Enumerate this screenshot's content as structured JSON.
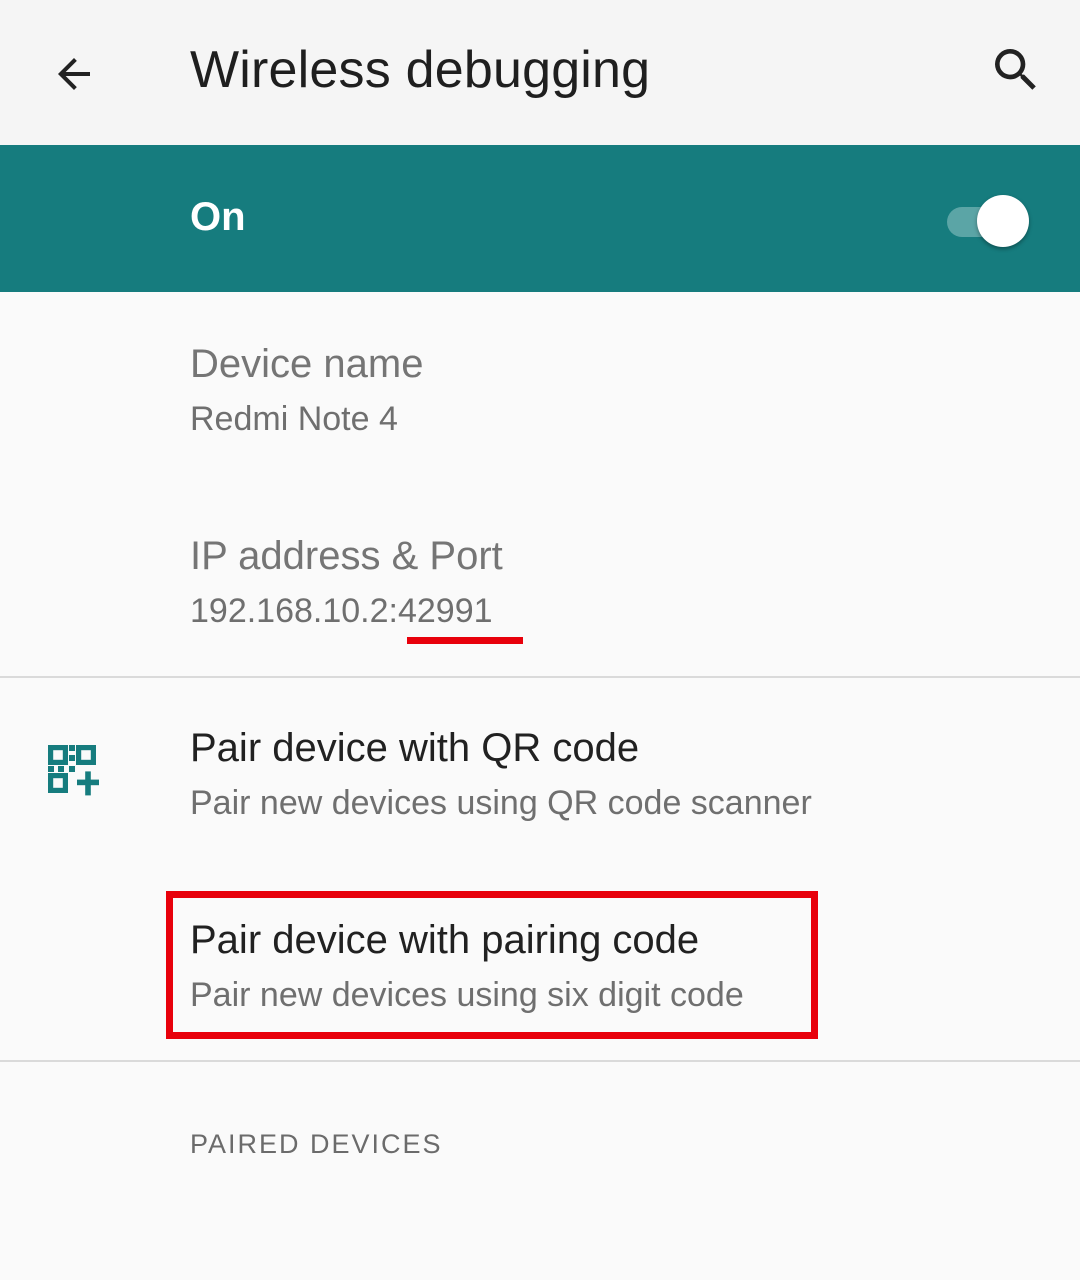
{
  "app_bar": {
    "title": "Wireless debugging",
    "back_icon": "arrow-back-icon",
    "search_icon": "search-icon"
  },
  "master_switch": {
    "label": "On",
    "checked": true,
    "background_color": "#167c7e"
  },
  "preferences": {
    "device_name": {
      "title": "Device name",
      "summary": "Redmi Note 4"
    },
    "ip_port": {
      "title": "IP address & Port",
      "summary": "192.168.10.2:42991"
    },
    "pair_qr": {
      "title": "Pair device with QR code",
      "summary": "Pair new devices using QR code scanner",
      "icon": "qr-code-add-icon"
    },
    "pair_code": {
      "title": "Pair device with pairing code",
      "summary": "Pair new devices using six digit code"
    }
  },
  "paired_devices_header": "PAIRED DEVICES",
  "annotations": {
    "underline_color": "#e8000b",
    "box_color": "#e8000b"
  }
}
